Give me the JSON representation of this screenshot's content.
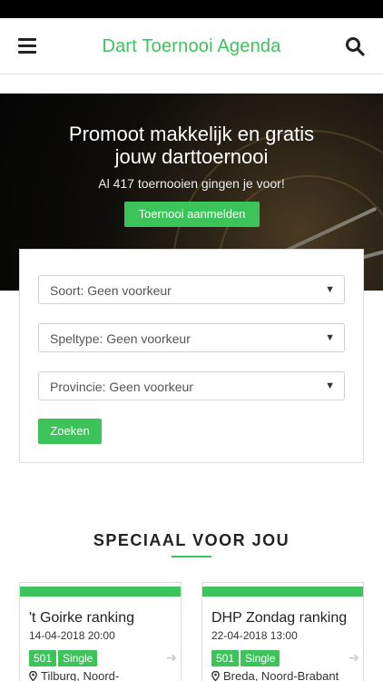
{
  "nav": {
    "title": "Dart Toernooi Agenda",
    "menu_icon": "hamburger-menu-icon",
    "search_icon": "search-icon"
  },
  "hero": {
    "title_line1": "Promoot makkelijk en gratis",
    "title_line2": "jouw darttoernooi",
    "subtitle": "Al 417 toernooien gingen je voor!",
    "button_label": "Toernooi aanmelden"
  },
  "filters": {
    "soort": "Soort: Geen voorkeur",
    "speltype": "Speltype: Geen voorkeur",
    "provincie": "Provincie: Geen voorkeur",
    "submit_label": "Zoeken"
  },
  "section": {
    "title": "SPECIAAL VOOR JOU"
  },
  "events": [
    {
      "title": "'t Goirke ranking",
      "date": "14-04-2018 20:00",
      "tags": [
        "501",
        "Single"
      ],
      "location": "Tilburg, Noord-"
    },
    {
      "title": "DHP Zondag ranking",
      "date": "22-04-2018 13:00",
      "tags": [
        "501",
        "Single"
      ],
      "location": "Breda, Noord-Brabant"
    }
  ],
  "colors": {
    "accent": "#3cc35a",
    "text": "#222222",
    "statusbar": "#000000"
  }
}
